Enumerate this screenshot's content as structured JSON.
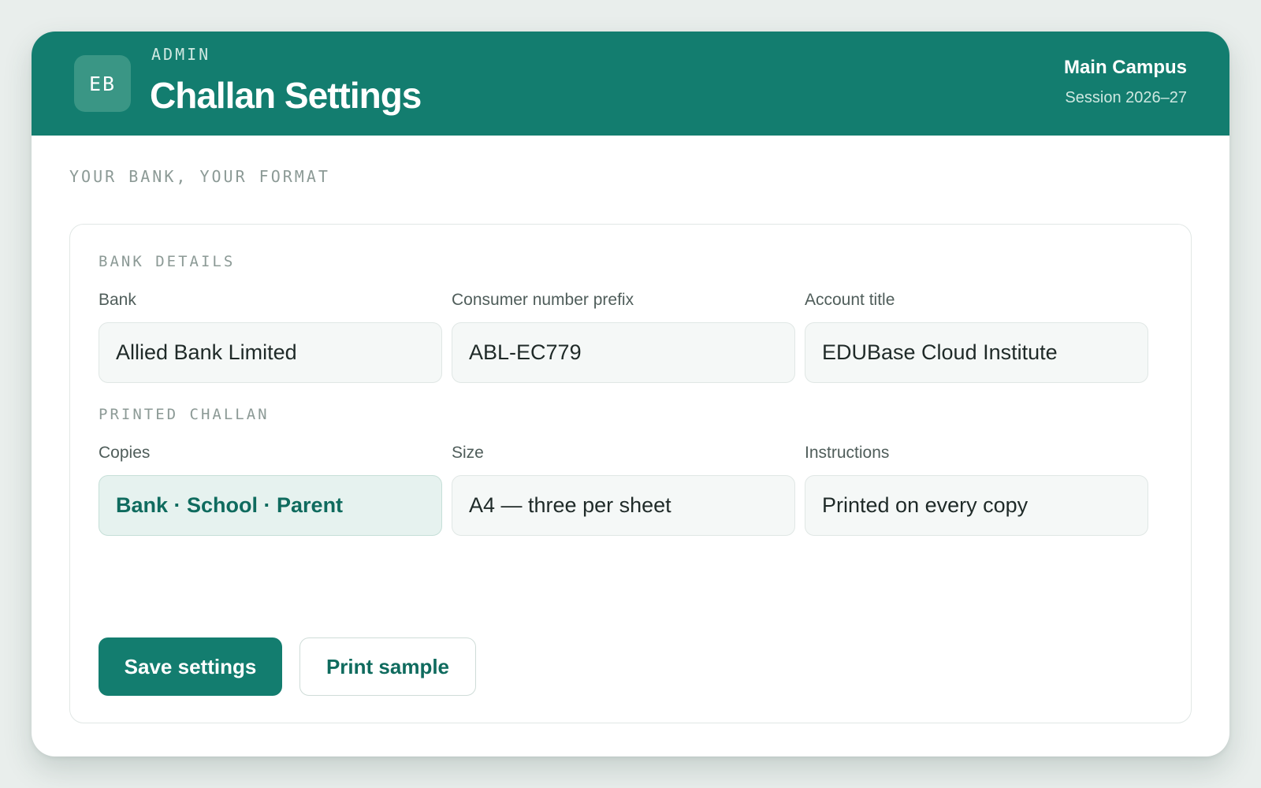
{
  "header": {
    "avatar_initials": "EB",
    "eyebrow": "ADMIN",
    "title": "Challan Settings",
    "campus": "Main Campus",
    "session": "Session 2026–27"
  },
  "tagline": "YOUR BANK, YOUR FORMAT",
  "bank_details": {
    "section_label": "BANK DETAILS",
    "bank": {
      "label": "Bank",
      "value": "Allied Bank Limited"
    },
    "consumer_prefix": {
      "label": "Consumer number prefix",
      "value": "ABL-EC779"
    },
    "account_title": {
      "label": "Account title",
      "value": "EDUBase Cloud Institute"
    }
  },
  "printed_challan": {
    "section_label": "PRINTED CHALLAN",
    "copies": {
      "label": "Copies",
      "value": "Bank · School · Parent"
    },
    "size": {
      "label": "Size",
      "value": "A4 — three per sheet"
    },
    "instructions": {
      "label": "Instructions",
      "value": "Printed on every copy"
    }
  },
  "actions": {
    "save_label": "Save settings",
    "print_label": "Print sample"
  },
  "colors": {
    "brand": "#137d6f",
    "page_background": "#e9eeec",
    "selected_field": "#e6f2ef"
  }
}
